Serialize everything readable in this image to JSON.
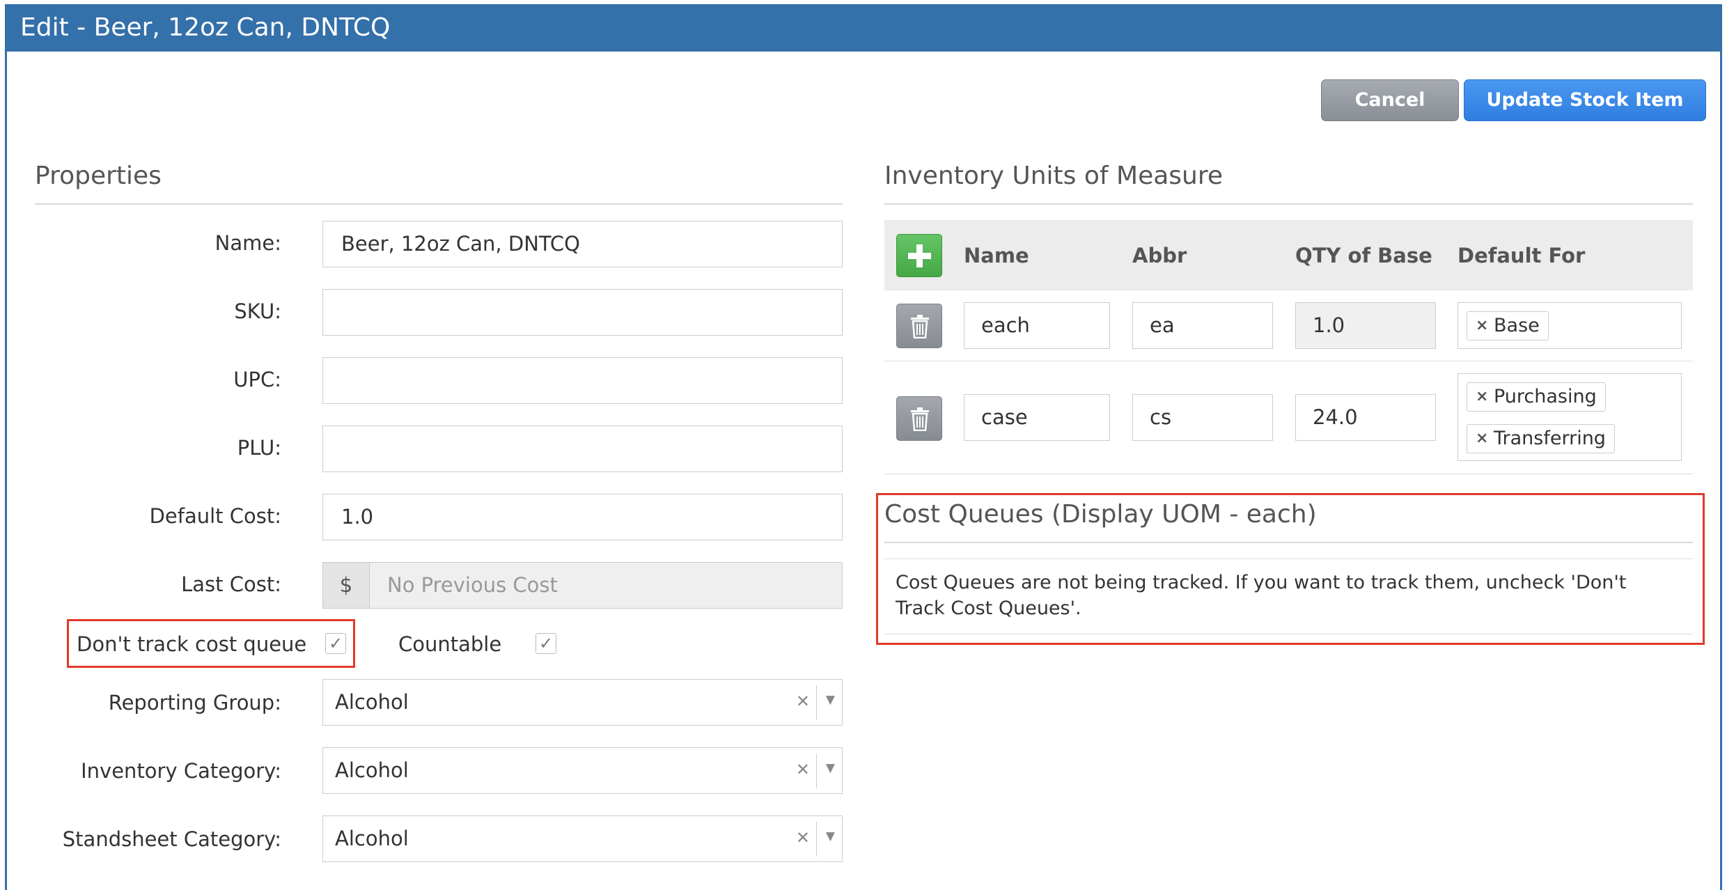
{
  "window": {
    "title": "Edit - Beer, 12oz Can, DNTCQ"
  },
  "toolbar": {
    "cancel_label": "Cancel",
    "update_label": "Update Stock Item"
  },
  "properties": {
    "heading": "Properties",
    "name_label": "Name:",
    "name_value": "Beer, 12oz Can, DNTCQ",
    "sku_label": "SKU:",
    "sku_value": "",
    "upc_label": "UPC:",
    "upc_value": "",
    "plu_label": "PLU:",
    "plu_value": "",
    "default_cost_label": "Default Cost:",
    "default_cost_value": "1.0",
    "last_cost_label": "Last Cost:",
    "last_cost_currency": "$",
    "last_cost_value": "No Previous Cost",
    "dont_track_label": "Don't track cost queue",
    "dont_track_checked": true,
    "countable_label": "Countable",
    "countable_checked": true,
    "reporting_group_label": "Reporting Group:",
    "reporting_group_value": "Alcohol",
    "inventory_category_label": "Inventory Category:",
    "inventory_category_value": "Alcohol",
    "standsheet_category_label": "Standsheet Category:",
    "standsheet_category_value": "Alcohol"
  },
  "uom": {
    "heading": "Inventory Units of Measure",
    "columns": [
      "Name",
      "Abbr",
      "QTY of Base",
      "Default For"
    ],
    "rows": [
      {
        "name": "each",
        "abbr": "ea",
        "qty": "1.0",
        "default_for": [
          "Base"
        ]
      },
      {
        "name": "case",
        "abbr": "cs",
        "qty": "24.0",
        "default_for": [
          "Purchasing",
          "Transferring"
        ]
      }
    ]
  },
  "cost_queues": {
    "heading": "Cost Queues (Display UOM - each)",
    "message": "Cost Queues are not being tracked. If you want to track them, uncheck 'Don't Track Cost Queues'."
  },
  "colors": {
    "header_bar": "#3470aa",
    "highlight_border": "#e03a2a",
    "primary_button": "#3a88e8",
    "add_button": "#52b152"
  },
  "icons": {
    "add": "plus-icon",
    "delete": "trash-icon",
    "clear": "clear-x-icon",
    "dropdown": "chevron-down-icon",
    "check": "checkmark-icon"
  }
}
